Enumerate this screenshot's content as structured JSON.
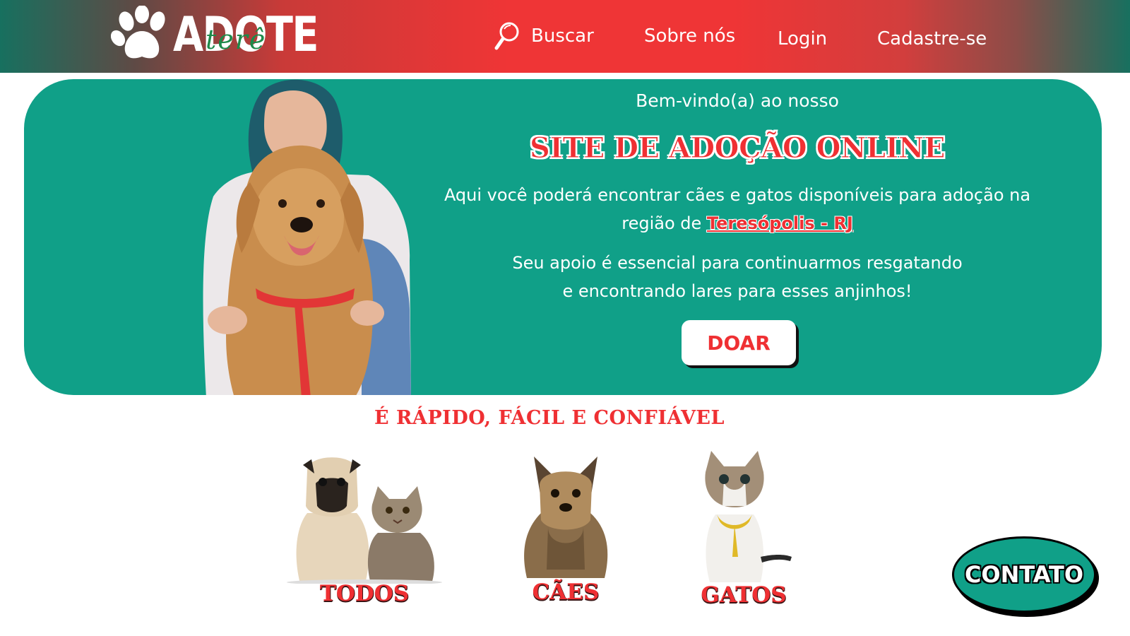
{
  "header": {
    "logo_text": "ADOTE",
    "logo_script": "terê",
    "nav": {
      "search_label": "Buscar",
      "about_label": "Sobre nós",
      "login_label": "Login",
      "signup_label": "Cadastre-se"
    }
  },
  "hero": {
    "welcome": "Bem-vindo(a) ao nosso",
    "title": "SITE DE ADOÇÃO ONLINE",
    "description_line1": "Aqui você poderá encontrar cães e gatos disponíveis para adoção na",
    "description_prefix": "região de ",
    "location_link": "Teresópolis - RJ",
    "support_line1": "Seu apoio é essencial para continuarmos resgatando",
    "support_line2": "e encontrando lares para esses anjinhos!",
    "donate_label": "DOAR"
  },
  "section": {
    "title": "É RÁPIDO, FÁCIL E CONFIÁVEL"
  },
  "categories": [
    {
      "label": "TODOS",
      "icon": "dog-and-cat-photo"
    },
    {
      "label": "CÃES",
      "icon": "dog-photo"
    },
    {
      "label": "GATOS",
      "icon": "cat-photo"
    }
  ],
  "contact_label": "CONTATO",
  "colors": {
    "brand_red": "#ef3033",
    "brand_teal": "#10a088",
    "header_edge": "#17705f",
    "white": "#ffffff"
  }
}
